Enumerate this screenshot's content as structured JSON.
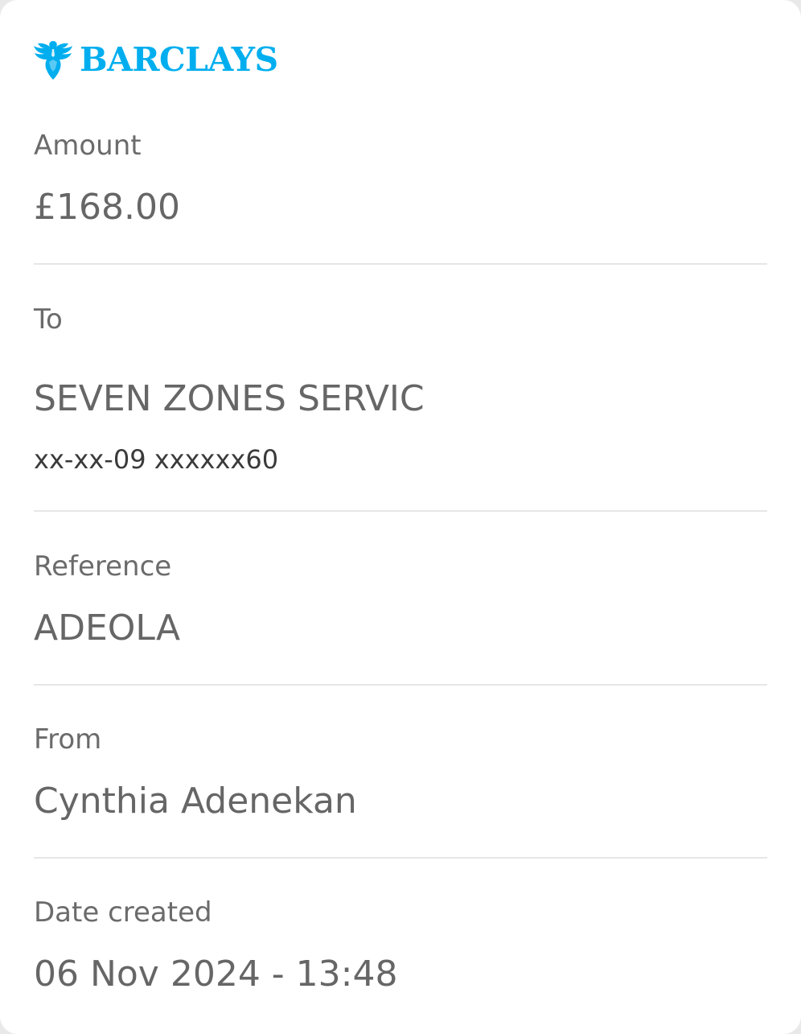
{
  "brand": {
    "name": "BARCLAYS",
    "logo_icon": "eagle-icon",
    "color": "#00aeef"
  },
  "amount": {
    "label": "Amount",
    "value": "£168.00"
  },
  "to": {
    "label": "To",
    "payee": "SEVEN ZONES SERVIC",
    "account": "xx-xx-09 xxxxxx60"
  },
  "reference": {
    "label": "Reference",
    "value": "ADEOLA"
  },
  "from": {
    "label": "From",
    "value": "Cynthia Adenekan"
  },
  "date_created": {
    "label": "Date created",
    "value": "06 Nov 2024 - 13:48"
  }
}
